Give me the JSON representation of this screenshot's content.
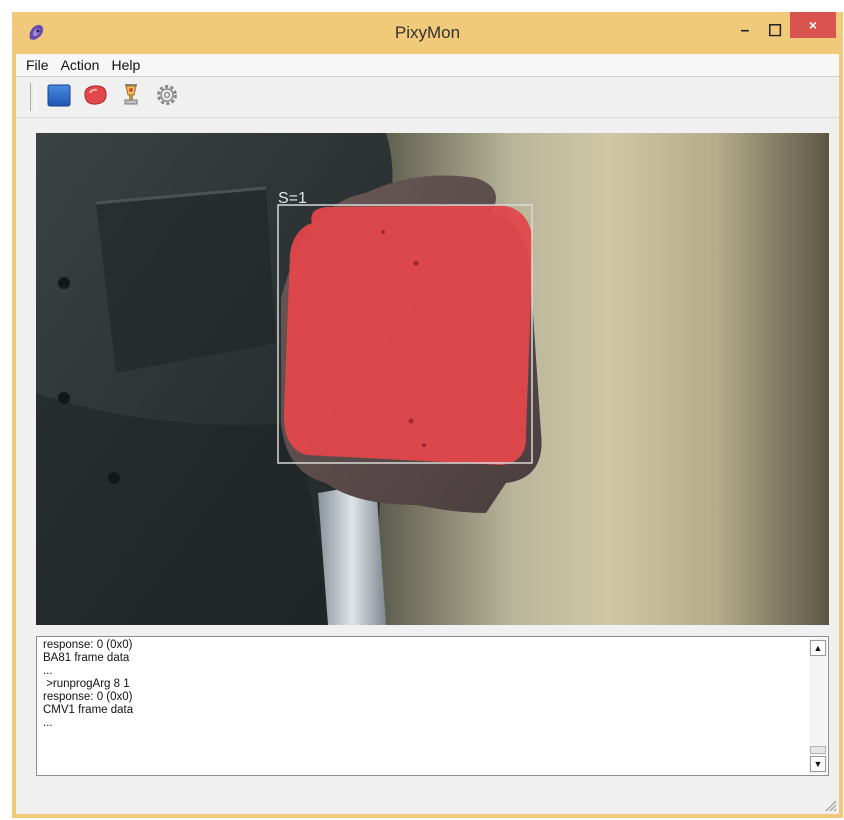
{
  "window": {
    "title": "PixyMon",
    "controls": {
      "minimize": "–",
      "maximize": "☐",
      "close": "×"
    }
  },
  "menu": {
    "items": [
      "File",
      "Action",
      "Help"
    ]
  },
  "toolbar": {
    "buttons": [
      "stop-icon",
      "blob-icon",
      "trophy-icon",
      "gear-icon"
    ]
  },
  "video": {
    "detection_label": "S=1",
    "colors": {
      "detection_fill": "#e2474b",
      "box_outline": "#d8d8d8"
    }
  },
  "console": {
    "lines": [
      "response: 0 (0x0)",
      "BA81 frame data",
      "...",
      " >runprogArg 8 1",
      "response: 0 (0x0)",
      "CMV1 frame data",
      "..."
    ]
  }
}
